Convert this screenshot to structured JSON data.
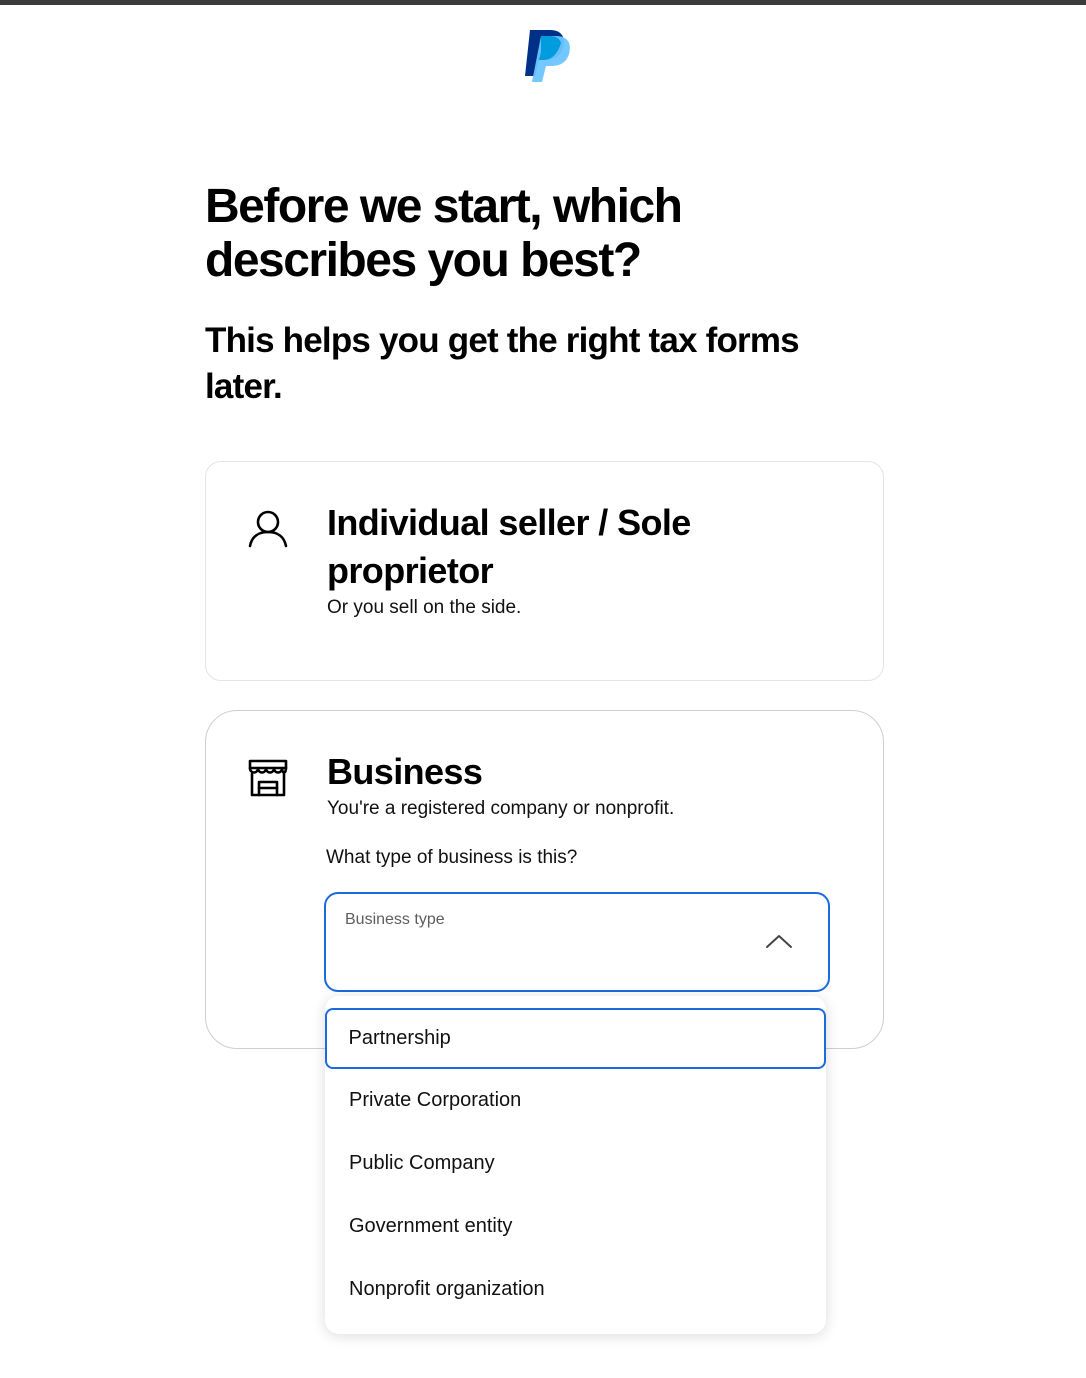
{
  "brand": {
    "logo_icon": "paypal-logo-icon",
    "colors": {
      "dark_blue": "#003087",
      "light_blue": "#009cde",
      "sky_blue": "#6cc5ff",
      "accent": "#1a6be0"
    }
  },
  "page": {
    "heading": "Before we start, which describes you best?",
    "subheading": "This helps you get the right tax forms later."
  },
  "options": {
    "individual": {
      "icon": "person-icon",
      "title": "Individual seller / Sole proprietor",
      "description": "Or you sell on the side."
    },
    "business": {
      "icon": "storefront-icon",
      "title": "Business",
      "description": "You're a registered company or nonprofit.",
      "question": "What type of business is this?",
      "select": {
        "label": "Business type",
        "value": "",
        "expanded": true,
        "chevron_icon": "chevron-up-icon"
      }
    }
  },
  "dropdown": {
    "items": [
      {
        "label": "Partnership",
        "focused": true
      },
      {
        "label": "Private Corporation",
        "focused": false
      },
      {
        "label": "Public Company",
        "focused": false
      },
      {
        "label": "Government entity",
        "focused": false
      },
      {
        "label": "Nonprofit organization",
        "focused": false
      }
    ]
  }
}
